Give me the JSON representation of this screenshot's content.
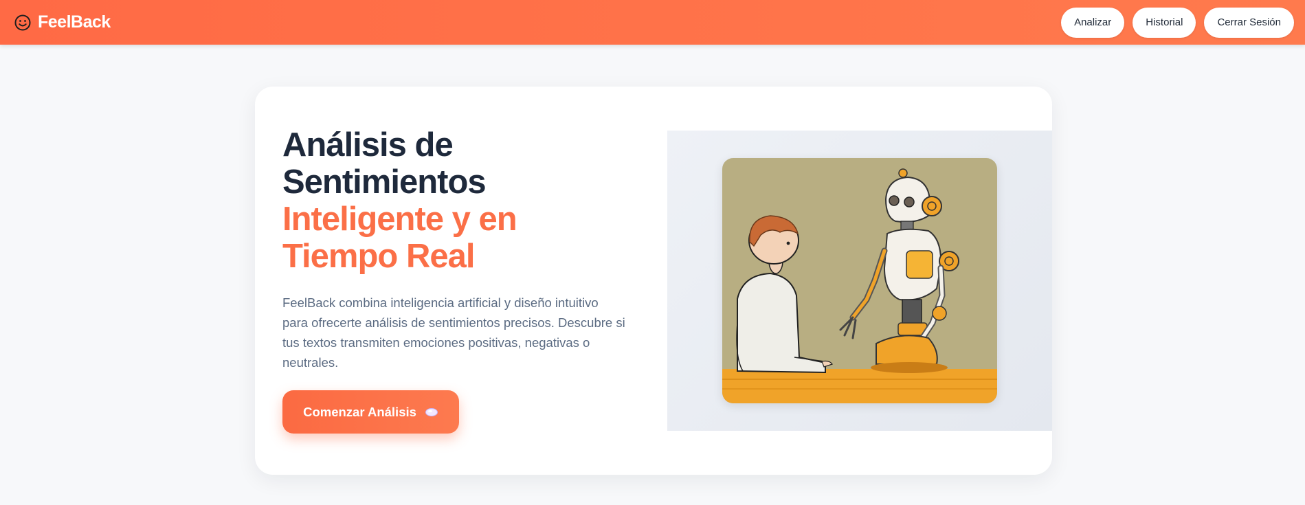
{
  "header": {
    "brand": "FeelBack",
    "nav": [
      "Analizar",
      "Historial",
      "Cerrar Sesión"
    ]
  },
  "hero": {
    "title_line1": "Análisis de",
    "title_line2": "Sentimientos",
    "accent_line1": "Inteligente y en",
    "accent_line2": "Tiempo Real",
    "description": "FeelBack combina inteligencia artificial y diseño intuitivo para ofrecerte análisis de sentimientos precisos. Descubre si tus textos transmiten emociones positivas, negativas o neutrales.",
    "cta_label": "Comenzar Análisis"
  },
  "icons": {
    "brand": "smiley-icon",
    "cta": "thought-bubble-icon"
  },
  "colors": {
    "brand_orange": "#ff6a45",
    "heading_dark": "#1e293b",
    "accent": "#fb6f47",
    "body_text": "#5b6b82"
  }
}
